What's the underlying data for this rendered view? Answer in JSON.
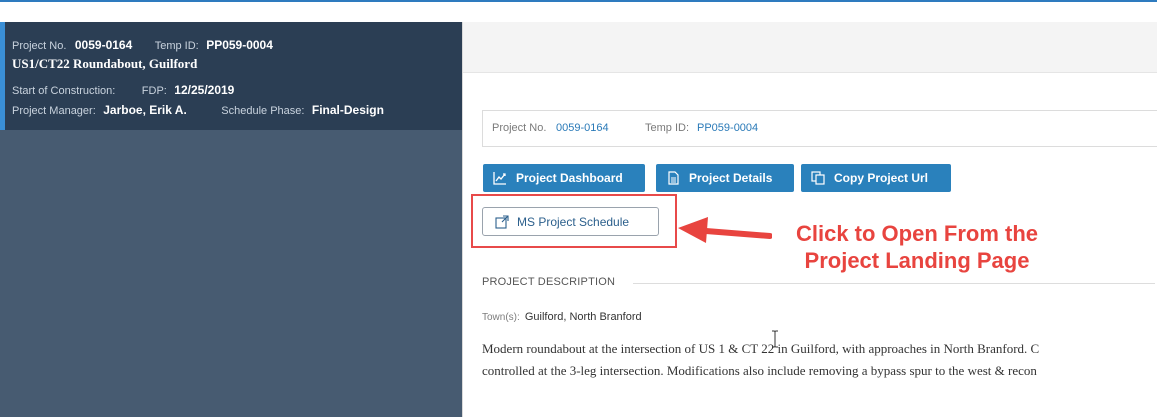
{
  "left_panel": {
    "project_no_label": "Project No.",
    "project_no": "0059-0164",
    "temp_id_label": "Temp ID:",
    "temp_id": "PP059-0004",
    "project_title": "US1/CT22 Roundabout, Guilford",
    "start_construction_label": "Start of Construction:",
    "fdp_label": "FDP:",
    "fdp_value": "12/25/2019",
    "manager_label": "Project Manager:",
    "manager_value": "Jarboe, Erik A.",
    "phase_label": "Schedule Phase:",
    "phase_value": "Final-Design"
  },
  "info_box": {
    "project_no_label": "Project No.",
    "project_no": "0059-0164",
    "temp_id_label": "Temp ID:",
    "temp_id": "PP059-0004"
  },
  "buttons": {
    "dashboard": "Project Dashboard",
    "details": "Project Details",
    "copy_url": "Copy Project Url",
    "ms_schedule": "MS Project Schedule"
  },
  "callout": {
    "line1": "Click to Open From the",
    "line2": "Project Landing Page"
  },
  "description": {
    "section_title": "PROJECT DESCRIPTION",
    "towns_label": "Town(s):",
    "towns_value": "Guilford, North Branford",
    "line1": "Modern roundabout at the intersection of US 1 & CT 22 in Guilford, with approaches in North Branford. C",
    "line2": "controlled at the 3-leg intersection. Modifications also include removing a bypass spur to the west & recon"
  },
  "colors": {
    "accent_blue": "#2a81bc",
    "panel_dark": "#2b3e54",
    "panel_mid": "#475b71",
    "callout_red": "#e8443f"
  }
}
